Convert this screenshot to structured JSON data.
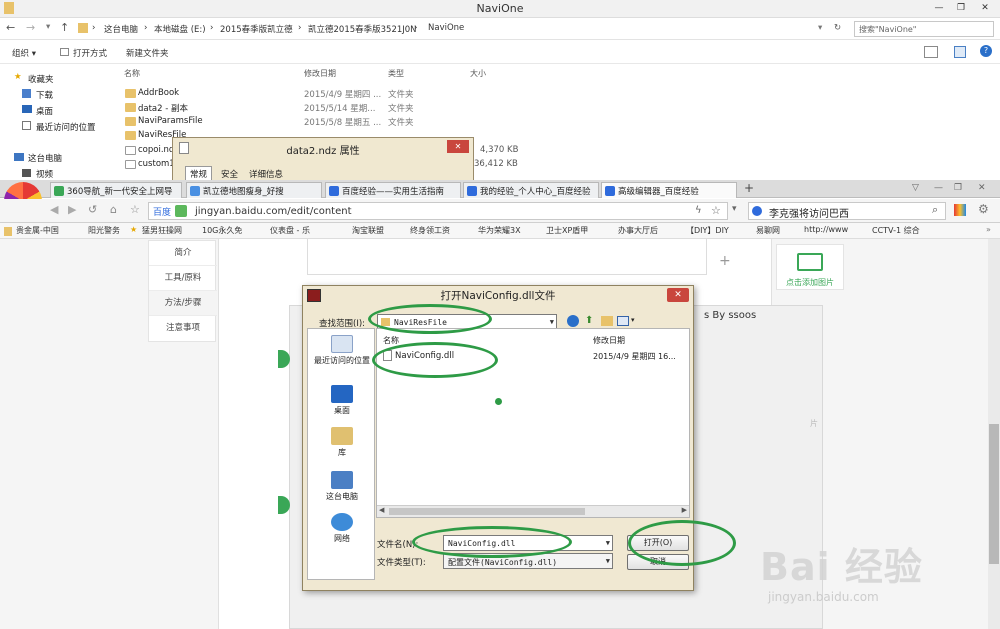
{
  "explorer": {
    "title": "NaviOne",
    "breadcrumb": [
      "这台电脑",
      "本地磁盘 (E:)",
      "2015春季版凯立德",
      "凯立德2015春季版3521J0N",
      "NaviOne"
    ],
    "search_placeholder": "搜索\"NaviOne\"",
    "toolbar": {
      "organize": "组织 ▾",
      "open_with": "打开方式",
      "new_folder": "新建文件夹"
    },
    "nav": {
      "favorites": "收藏夹",
      "download": "下载",
      "desktop": "桌面",
      "recent": "最近访问的位置",
      "this_pc": "这台电脑",
      "video": "视频"
    },
    "columns": {
      "name": "名称",
      "date": "修改日期",
      "type": "类型",
      "size": "大小"
    },
    "files": [
      {
        "name": "AddrBook",
        "date": "2015/4/9 星期四 ...",
        "type": "文件夹",
        "size": ""
      },
      {
        "name": "data2 - 副本",
        "date": "2015/5/14 星期...",
        "type": "文件夹",
        "size": ""
      },
      {
        "name": "NaviParamsFile",
        "date": "2015/5/8 星期五 ...",
        "type": "文件夹",
        "size": ""
      },
      {
        "name": "NaviResFile",
        "date": "",
        "type": "",
        "size": ""
      },
      {
        "name": "copoi.nd",
        "date": "",
        "type": "",
        "size": "4,370 KB"
      },
      {
        "name": "custom1.",
        "date": "",
        "type": "",
        "size": "36,412 KB"
      }
    ]
  },
  "props_dialog": {
    "title": "data2.ndz 属性",
    "tabs": [
      "常规",
      "安全",
      "详细信息"
    ]
  },
  "browser": {
    "tabs": [
      {
        "label": "360导航_新一代安全上网导",
        "color": "#3aa757"
      },
      {
        "label": "凯立德地图瘦身_好搜",
        "color": "#4a90e2"
      },
      {
        "label": "百度经验——实用生活指南",
        "color": "#2f6bdc"
      },
      {
        "label": "我的经验_个人中心_百度经验",
        "color": "#2f6bdc"
      },
      {
        "label": "高级编辑器_百度经验",
        "color": "#2f6bdc"
      }
    ],
    "new_tab": "+",
    "url_badge": "百度",
    "url": "jingyan.baidu.com/edit/content",
    "search_value": "李克强将访问巴西",
    "bookmarks": [
      "贵金属-中国",
      "阳光警务",
      "猛男狂操网",
      "10G永久免",
      "仪表盘 - 乐",
      "淘宝联盟",
      "终身领工资",
      "华为荣耀3X",
      "卫士XP盾甲",
      "办事大厅后",
      "【DIY】DIY",
      "易聊网",
      "http://www",
      "CCTV-1 综合"
    ]
  },
  "page": {
    "left_nav": [
      "简介",
      "工具/原料",
      "方法/步骤",
      "注意事项"
    ],
    "add_image": "点击添加图片",
    "plus": "+",
    "bg_panel_text": "s By ssoos",
    "side_text": "片"
  },
  "open_dialog": {
    "title": "打开NaviConfig.dll文件",
    "look_in_label": "查找范围(I):",
    "look_in_value": "NaviResFile",
    "places": [
      "最近访问的位置",
      "桌面",
      "库",
      "这台电脑",
      "网络"
    ],
    "list_headers": {
      "name": "名称",
      "date": "修改日期"
    },
    "files": [
      {
        "name": "NaviConfig.dll",
        "date": "2015/4/9 星期四 16..."
      }
    ],
    "filename_label": "文件名(N):",
    "filename_value": "NaviConfig.dll",
    "filetype_label": "文件类型(T):",
    "filetype_value": "配置文件(NaviConfig.dll)",
    "open_button": "打开(O)",
    "cancel_button": "取消"
  },
  "watermark": {
    "logo": "Bai 经验",
    "url": "jingyan.baidu.com"
  },
  "colors": {
    "highlight_oval": "#2e9b46",
    "dialog_bg": "#f0e8d2",
    "close_red": "#c9463d"
  }
}
